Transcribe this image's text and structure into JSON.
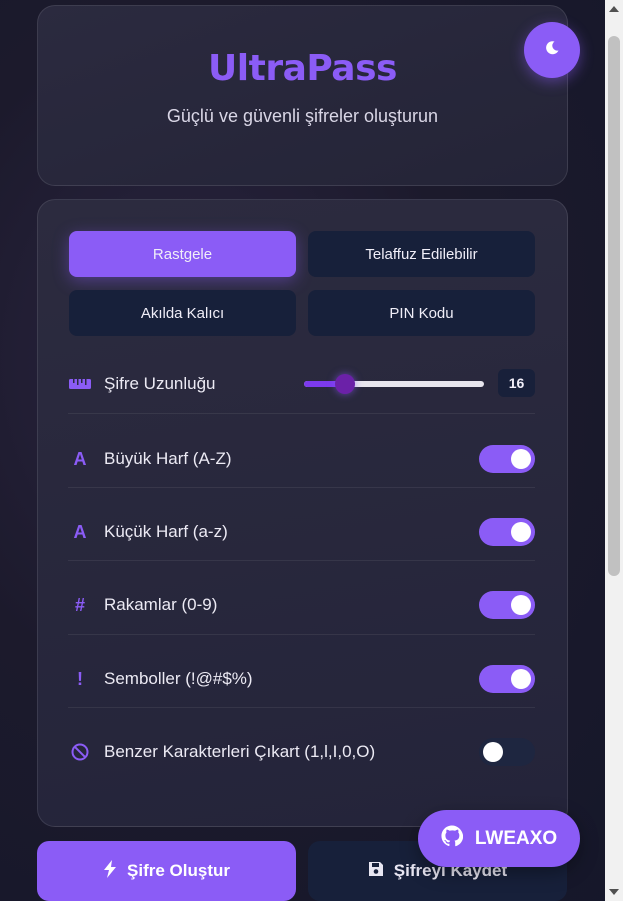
{
  "header": {
    "title": "UltraPass",
    "subtitle": "Güçlü ve güvenli şifreler oluşturun",
    "theme_icon": "moon-icon"
  },
  "modes": [
    {
      "label": "Rastgele",
      "active": true
    },
    {
      "label": "Telaffuz Edilebilir",
      "active": false
    },
    {
      "label": "Akılda Kalıcı",
      "active": false
    },
    {
      "label": "PIN Kodu",
      "active": false
    }
  ],
  "length": {
    "label": "Şifre Uzunluğu",
    "value": "16",
    "slider_fraction": 0.23,
    "icon": "ruler-icon"
  },
  "options": [
    {
      "label": "Büyük Harf (A-Z)",
      "icon": "A",
      "enabled": true
    },
    {
      "label": "Küçük Harf (a-z)",
      "icon": "A",
      "enabled": true
    },
    {
      "label": "Rakamlar (0-9)",
      "icon": "#",
      "enabled": true
    },
    {
      "label": "Semboller (!@#$%)",
      "icon": "!",
      "enabled": true
    },
    {
      "label": "Benzer Karakterleri Çıkart (1,l,I,0,O)",
      "icon": "ban-icon",
      "enabled": false
    }
  ],
  "actions": {
    "generate_label": "Şifre Oluştur",
    "save_label": "Şifreyi Kaydet"
  },
  "github": {
    "label": "LWEAXO"
  },
  "colors": {
    "accent": "#8b5cf6",
    "button_dark": "#17203a"
  }
}
